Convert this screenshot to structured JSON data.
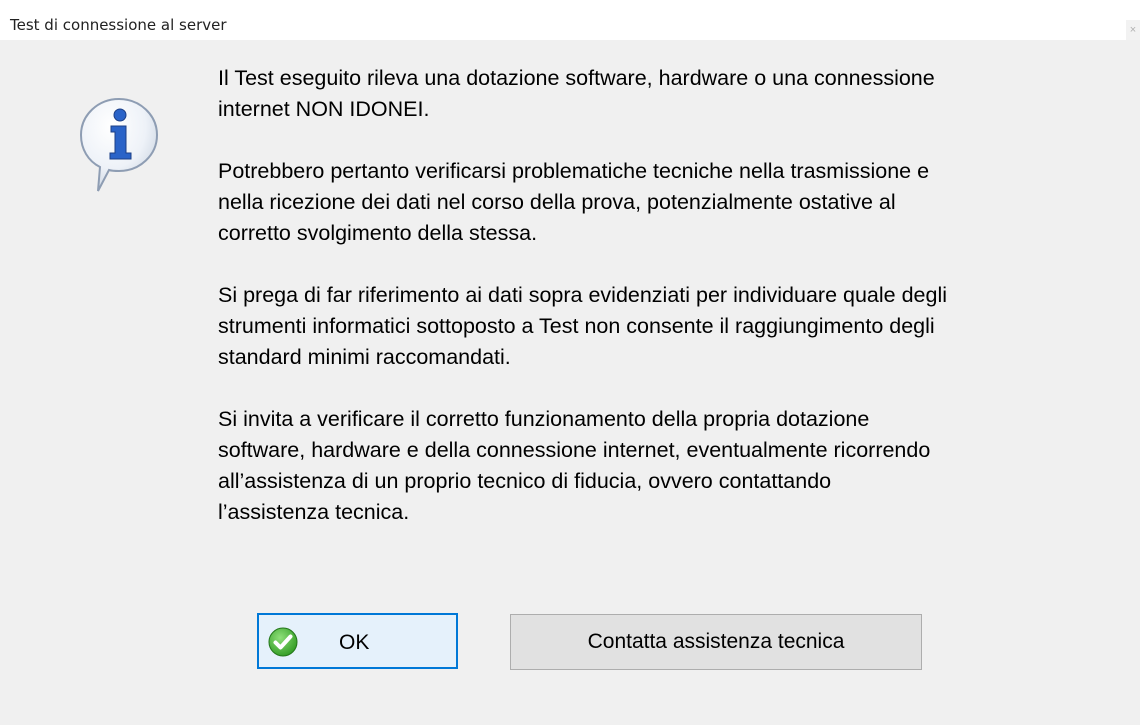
{
  "window": {
    "title": "Test di connessione al server",
    "close_glyph": "×"
  },
  "dialog": {
    "icon": "info-balloon-icon",
    "paragraphs": [
      "Il Test eseguito rileva una dotazione software, hardware o una connessione\ninternet NON IDONEI.",
      "Potrebbero pertanto verificarsi problematiche tecniche nella trasmissione e\nnella ricezione dei dati nel corso della prova, potenzialmente ostative al\ncorretto svolgimento della stessa.",
      "Si prega di far riferimento ai dati sopra evidenziati per individuare quale degli\nstrumenti informatici sottoposto a Test non consente il raggiungimento degli\nstandard minimi raccomandati.",
      "Si invita a verificare il corretto funzionamento della propria dotazione\nsoftware, hardware e della connessione internet, eventualmente ricorrendo\nall’assistenza di un proprio tecnico di fiducia, ovvero contattando\nl’assistenza tecnica."
    ]
  },
  "buttons": {
    "ok_label": "OK",
    "ok_icon": "green-check-icon",
    "assist_label": "Contatta assistenza tecnica"
  },
  "colors": {
    "dialog_background": "#f0f0f0",
    "ok_border": "#0078d7",
    "ok_fill": "#e5f1fb",
    "button_fill": "#e1e1e1",
    "icon_blue": "#2a63c8",
    "check_green": "#3cab2e"
  }
}
